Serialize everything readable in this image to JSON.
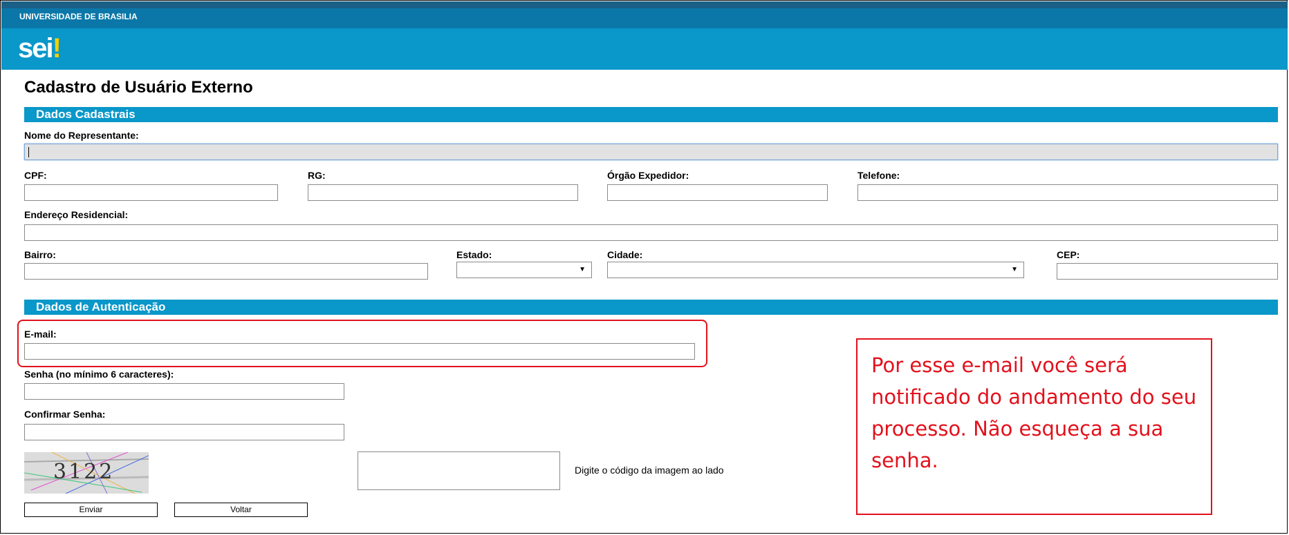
{
  "header": {
    "university": "UNIVERSIDADE DE BRASILIA",
    "logo_text": "sei",
    "logo_mark": "!"
  },
  "page": {
    "title": "Cadastro de Usuário Externo"
  },
  "sections": {
    "cadastrais": "Dados Cadastrais",
    "autenticacao": "Dados de Autenticação"
  },
  "fields": {
    "nome": {
      "label": "Nome do Representante:",
      "value": ""
    },
    "cpf": {
      "label": "CPF:",
      "value": ""
    },
    "rg": {
      "label": "RG:",
      "value": ""
    },
    "orgao": {
      "label": "Órgão Expedidor:",
      "value": ""
    },
    "telefone": {
      "label": "Telefone:",
      "value": ""
    },
    "endereco": {
      "label": "Endereço Residencial:",
      "value": ""
    },
    "bairro": {
      "label": "Bairro:",
      "value": ""
    },
    "estado": {
      "label": "Estado:",
      "value": ""
    },
    "cidade": {
      "label": "Cidade:",
      "value": ""
    },
    "cep": {
      "label": "CEP:",
      "value": ""
    },
    "email": {
      "label": "E-mail:",
      "value": ""
    },
    "senha": {
      "label": "Senha (no mínimo 6 caracteres):",
      "value": ""
    },
    "confirmar": {
      "label": "Confirmar Senha:",
      "value": ""
    }
  },
  "captcha": {
    "code": "3122",
    "hint": "Digite o código da imagem ao lado"
  },
  "buttons": {
    "enviar": "Enviar",
    "voltar": "Voltar"
  },
  "callout": {
    "text": "Por esse e-mail você será notificado do andamento do seu processo. Não esqueça a sua senha."
  },
  "colors": {
    "header_blue": "#0a97c9",
    "annotation_red": "#e2111c"
  }
}
